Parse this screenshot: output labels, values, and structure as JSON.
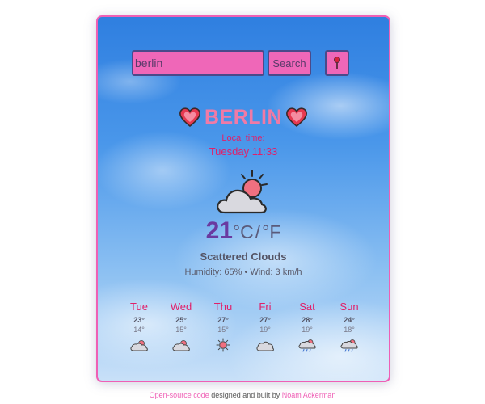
{
  "search": {
    "value": "berlin",
    "button_label": "Search"
  },
  "location": {
    "city": "BERLIN",
    "local_time_label": "Local time:",
    "local_time": "Tuesday 11:33"
  },
  "current": {
    "temperature": "21",
    "unit_celsius": "°C",
    "unit_separator": "/",
    "unit_fahrenheit": "°F",
    "description": "Scattered Clouds",
    "details": "Humidity: 65% • Wind: 3 km/h",
    "icon": "partly-cloudy-icon"
  },
  "forecast": [
    {
      "day": "Tue",
      "high": "23°",
      "low": "14°",
      "icon": "partly-cloudy-icon"
    },
    {
      "day": "Wed",
      "high": "25°",
      "low": "15°",
      "icon": "partly-cloudy-icon"
    },
    {
      "day": "Thu",
      "high": "27°",
      "low": "15°",
      "icon": "sun-icon"
    },
    {
      "day": "Fri",
      "high": "27°",
      "low": "19°",
      "icon": "cloud-icon"
    },
    {
      "day": "Sat",
      "high": "28°",
      "low": "19°",
      "icon": "rain-cloud-icon"
    },
    {
      "day": "Sun",
      "high": "24°",
      "low": "18°",
      "icon": "rain-cloud-icon"
    }
  ],
  "footer": {
    "link_source": "Open-source code",
    "middle_text": " designed and built by ",
    "link_author": "Noam Ackerman"
  },
  "colors": {
    "accent": "#ef67b8",
    "border": "#ef5fb5",
    "city": "#f07aa6",
    "red_text": "#e0206a",
    "temp": "#6a3aa0"
  }
}
